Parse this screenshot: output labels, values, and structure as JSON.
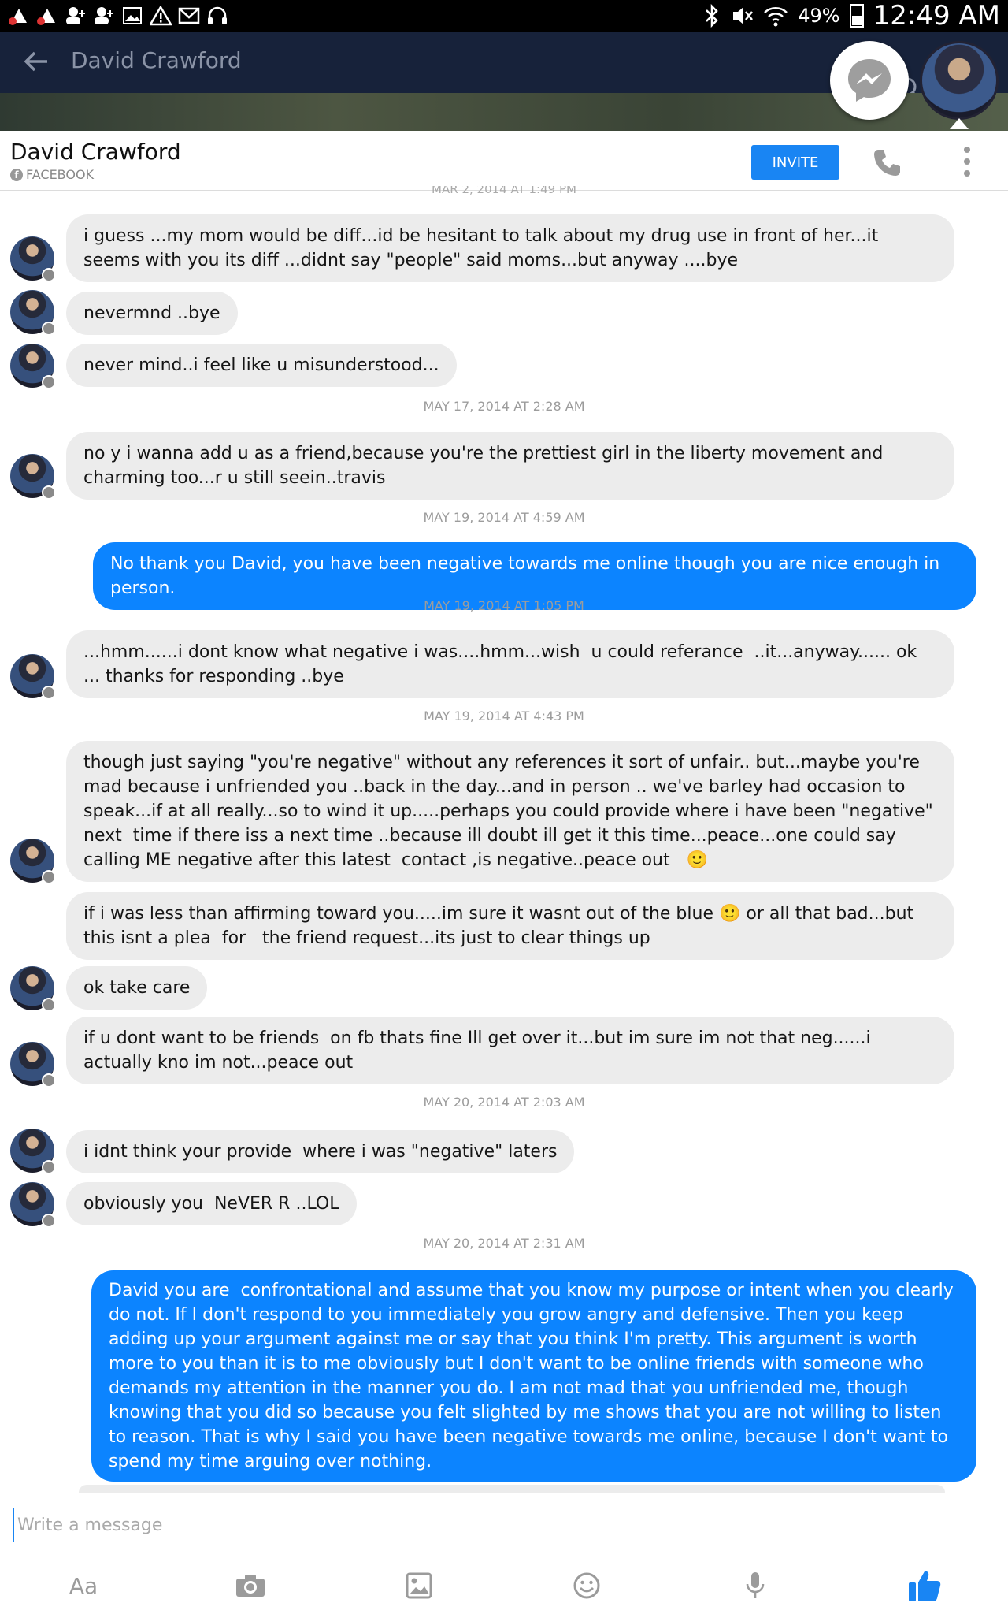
{
  "status_bar": {
    "battery": "49%",
    "time": "12:49 AM"
  },
  "background_app": {
    "title": "David Crawford"
  },
  "header": {
    "contact_name": "David Crawford",
    "source": "FACEBOOK",
    "invite_label": "INVITE"
  },
  "cut_timestamp": "MAR 2, 2014 AT 1:49 PM",
  "messages": [
    {
      "id": "m1",
      "text": "i guess ...my mom would be diff...id be hesitant to talk about my drug use in front of her...it seems with you its diff ...didnt say \"people\" said moms...but anyway ....bye"
    },
    {
      "id": "m2",
      "text": "nevermnd ..bye"
    },
    {
      "id": "m3",
      "text": "never mind..i feel like u misunderstood..."
    },
    {
      "id": "t1",
      "text": "MAY 17, 2014 AT 2:28 AM"
    },
    {
      "id": "m4",
      "text": "no y i wanna add u as a friend,because you're the prettiest girl in the liberty movement and charming too...r u still seein..travis"
    },
    {
      "id": "t2",
      "text": "MAY 19, 2014 AT 4:59 AM"
    },
    {
      "id": "m5",
      "text": "No thank you David, you have been negative towards me online though you are nice enough in person."
    },
    {
      "id": "t3",
      "text": "MAY 19, 2014 AT 1:05 PM"
    },
    {
      "id": "m6",
      "text": "...hmm......i dont know what negative i was....hmm...wish  u could referance  ..it...anyway...... ok ... thanks for responding ..bye"
    },
    {
      "id": "t4",
      "text": "MAY 19, 2014 AT 4:43 PM"
    },
    {
      "id": "m7",
      "text": "though just saying \"you're negative\" without any references it sort of unfair.. but...maybe you're mad because i unfriended you ..back in the day...and in person .. we've barley had occasion to speak...if at all really...so to wind it up.....perhaps you could provide where i have been \"negative\" next  time if there iss a next time ..because ill doubt ill get it this time...peace...one could say calling ME negative after this latest  contact ,is negative..peace out   🙂"
    },
    {
      "id": "m8",
      "text": "if i was less than affirming toward you.....im sure it wasnt out of the blue 🙂 or all that bad...but this isnt a plea  for   the friend request...its just to clear things up"
    },
    {
      "id": "m9",
      "text": "ok take care"
    },
    {
      "id": "m10",
      "text": "if u dont want to be friends  on fb thats fine Ill get over it...but im sure im not that neg......i actually kno im not...peace out"
    },
    {
      "id": "t5",
      "text": "MAY 20, 2014 AT 2:03 AM"
    },
    {
      "id": "m11",
      "text": "i idnt think your provide  where i was \"negative\" laters"
    },
    {
      "id": "m12",
      "text": "obviously you  NeVER R ..LOL"
    },
    {
      "id": "t6",
      "text": "MAY 20, 2014 AT 2:31 AM"
    },
    {
      "id": "m13",
      "text": "David you are  confrontational and assume that you know my purpose or intent when you clearly do not. If I don't respond to you immediately you grow angry and defensive. Then you keep adding up your argument against me or say that you think I'm pretty. This argument is worth more to you than it is to me obviously but I don't want to be online friends with someone who demands my attention in the manner you do. I am not mad that you unfriended me, though knowing that you did so because you felt slighted by me shows that you are not willing to listen to reason. That is why I said you have been negative towards me online, because I don't want to spend my time arguing over nothing."
    }
  ],
  "composer": {
    "placeholder": "Write a message",
    "text_format_label": "Aa"
  },
  "colors": {
    "accent": "#1985f3",
    "outgoing_bubble": "#0c84ff",
    "incoming_bubble": "#ececec",
    "header_bg": "#17223a"
  },
  "icons": [
    "bluetooth-icon",
    "mute-icon",
    "wifi-icon",
    "messenger-icon",
    "back-arrow-icon",
    "phone-icon",
    "more-vertical-icon",
    "camera-icon",
    "image-icon",
    "emoji-icon",
    "microphone-icon",
    "thumbs-up-icon"
  ]
}
